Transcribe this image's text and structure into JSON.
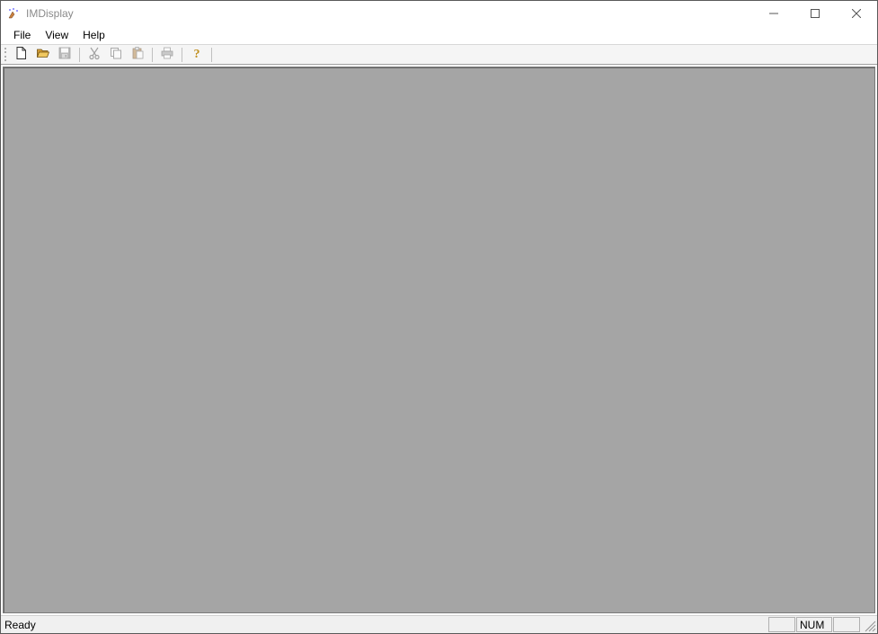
{
  "window": {
    "title": "IMDisplay"
  },
  "menu": {
    "items": [
      "File",
      "View",
      "Help"
    ]
  },
  "toolbar": {
    "new": "new-icon",
    "open": "open-icon",
    "save": "save-icon",
    "cut": "cut-icon",
    "copy": "copy-icon",
    "paste": "paste-icon",
    "print": "print-icon",
    "help": "help-icon"
  },
  "status": {
    "text": "Ready",
    "cell1": "",
    "cell2": "NUM",
    "cell3": ""
  }
}
